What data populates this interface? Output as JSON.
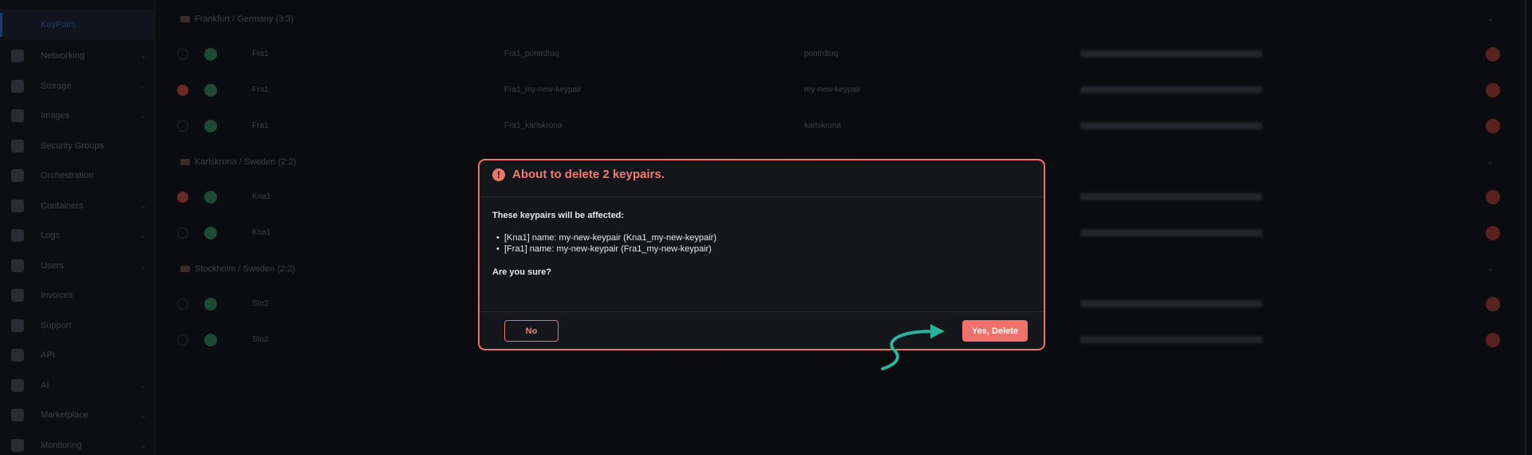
{
  "sidebar": {
    "active_item": "KeyPairs",
    "items": [
      {
        "label": "Networking",
        "icon": "network-icon",
        "chevron": true
      },
      {
        "label": "Storage",
        "icon": "storage-icon",
        "chevron": true
      },
      {
        "label": "Images",
        "icon": "camera-icon",
        "chevron": true
      },
      {
        "label": "Security Groups",
        "icon": "shield-icon",
        "chevron": false
      },
      {
        "label": "Orchestration",
        "icon": "flame-icon",
        "chevron": false
      },
      {
        "label": "Containers",
        "icon": "globe-icon",
        "chevron": true
      },
      {
        "label": "Logs",
        "icon": "history-icon",
        "chevron": true
      },
      {
        "label": "Users",
        "icon": "user-icon",
        "chevron": true
      },
      {
        "label": "Invoices",
        "icon": "invoice-icon",
        "chevron": false
      },
      {
        "label": "Support",
        "icon": "support-icon",
        "chevron": false
      },
      {
        "label": "API",
        "icon": "plug-icon",
        "chevron": false
      },
      {
        "label": "AI",
        "icon": "ai-icon",
        "chevron": true
      },
      {
        "label": "Marketplace",
        "icon": "cart-icon",
        "chevron": true
      },
      {
        "label": "Monitoring",
        "icon": "chart-icon",
        "chevron": true
      }
    ]
  },
  "groups": [
    {
      "header": "Frankfurt / Germany (3:3)",
      "rows": [
        {
          "selected": false,
          "region": "Fra1",
          "id": "Fra1_pontrdtuq",
          "name": "pontrdtuq"
        },
        {
          "selected": true,
          "region": "Fra1",
          "id": "Fra1_my-new-keypair",
          "name": "my-new-keypair"
        },
        {
          "selected": false,
          "region": "Fra1",
          "id": "Fra1_karlskrona",
          "name": "karlskrona"
        }
      ]
    },
    {
      "header": "Karlskrona / Sweden (2:2)",
      "rows": [
        {
          "selected": true,
          "region": "Kna1"
        },
        {
          "selected": false,
          "region": "Kna1"
        }
      ]
    },
    {
      "header": "Stockholm / Sweden (2:2)",
      "rows": [
        {
          "selected": false,
          "region": "Sto2"
        },
        {
          "selected": false,
          "region": "Sto2"
        }
      ]
    }
  ],
  "modal": {
    "title": "About to delete 2 keypairs.",
    "affected_label": "These keypairs will be affected:",
    "items": [
      "[Kna1] name: my-new-keypair (Kna1_my-new-keypair)",
      "[Fra1] name: my-new-keypair (Fra1_my-new-keypair)"
    ],
    "confirm_question": "Are you sure?",
    "no_label": "No",
    "yes_label": "Yes, Delete"
  },
  "colors": {
    "accent": "#e8776a",
    "danger_button": "#f0706a",
    "annotation_arrow": "#2bb39a"
  }
}
